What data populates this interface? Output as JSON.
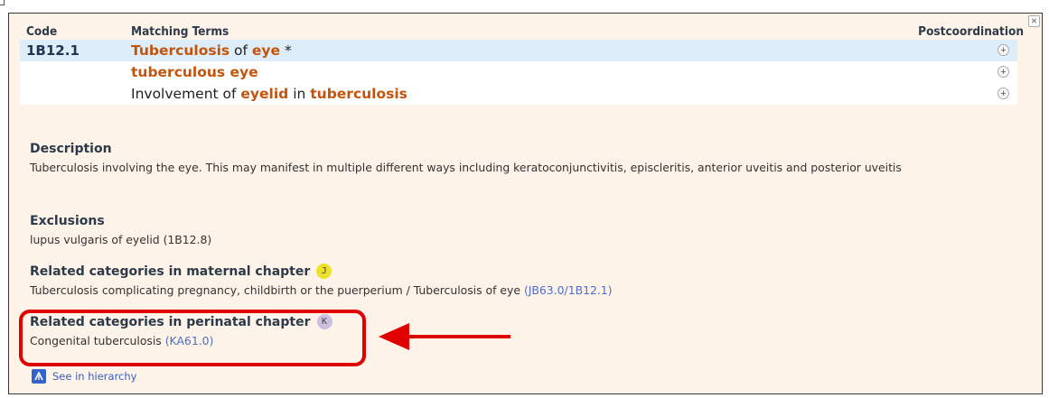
{
  "close_glyph": "×",
  "table": {
    "header": {
      "code": "Code",
      "terms": "Matching Terms",
      "postcoordination": "Postcoordination"
    },
    "rows": [
      {
        "code": "1B12.1",
        "parts": [
          {
            "text": "Tuberculosis",
            "hl": true
          },
          {
            "text": " of ",
            "hl": false
          },
          {
            "text": "eye",
            "hl": true
          },
          {
            "text": " *",
            "hl": false
          }
        ],
        "selected": true
      },
      {
        "code": "",
        "parts": [
          {
            "text": "tuberculous eye",
            "hl": true
          }
        ],
        "selected": false
      },
      {
        "code": "",
        "parts": [
          {
            "text": "Involvement of ",
            "hl": false
          },
          {
            "text": "eyelid",
            "hl": true
          },
          {
            "text": " in ",
            "hl": false
          },
          {
            "text": "tuberculosis",
            "hl": true
          }
        ],
        "selected": false
      }
    ],
    "plus_glyph": "+"
  },
  "description": {
    "title": "Description",
    "text": "Tuberculosis involving the eye. This may manifest in multiple different ways including keratoconjunctivitis, episcleritis, anterior uveitis and posterior uveitis"
  },
  "exclusions": {
    "title": "Exclusions",
    "text": "lupus vulgaris of eyelid (1B12.8)"
  },
  "maternal": {
    "title": "Related categories in maternal chapter",
    "badge": "J",
    "text": "Tuberculosis complicating pregnancy, childbirth or the puerperium / Tuberculosis of eye",
    "link": "(JB63.0/1B12.1)"
  },
  "perinatal": {
    "title": "Related categories in perinatal chapter",
    "badge": "K",
    "text": "Congenital tuberculosis",
    "link": "(KA61.0)"
  },
  "hierarchy": {
    "label": "See in hierarchy"
  },
  "colors": {
    "highlight": "#c4530c",
    "link": "#4f6dc9",
    "annotation": "#e00000",
    "panel_bg": "#fdf3e8",
    "selected_row": "#ddeefa"
  }
}
